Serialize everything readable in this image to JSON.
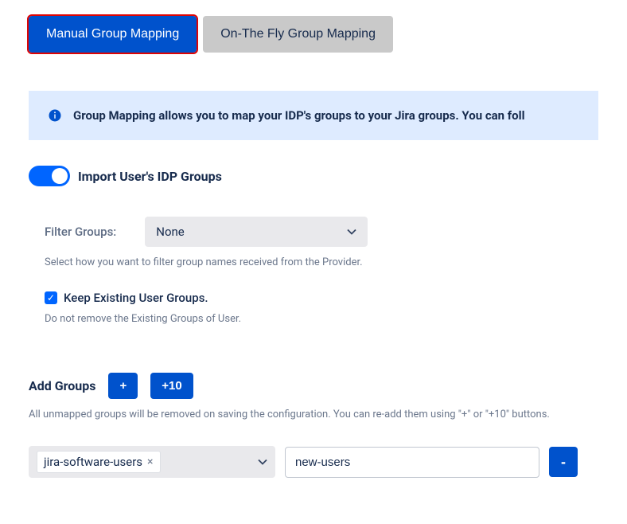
{
  "tabs": {
    "manual": "Manual Group Mapping",
    "onthefly": "On-The Fly Group Mapping"
  },
  "banner": {
    "text": "Group Mapping allows you to map your IDP's groups to your Jira groups. You can foll"
  },
  "toggle": {
    "label": "Import User's IDP Groups"
  },
  "filter": {
    "label": "Filter Groups:",
    "selected": "None",
    "help": "Select how you want to filter group names received from the Provider."
  },
  "keep_existing": {
    "label": "Keep Existing User Groups.",
    "help": "Do not remove the Existing Groups of User."
  },
  "add_groups": {
    "label": "Add Groups",
    "plus_label": "+",
    "plus10_label": "+10",
    "help": "All unmapped groups will be removed on saving the configuration. You can re-add them using \"+\" or \"+10\" buttons."
  },
  "mapping": {
    "tag_value": "jira-software-users",
    "input_value": "new-users",
    "remove_label": "-"
  }
}
